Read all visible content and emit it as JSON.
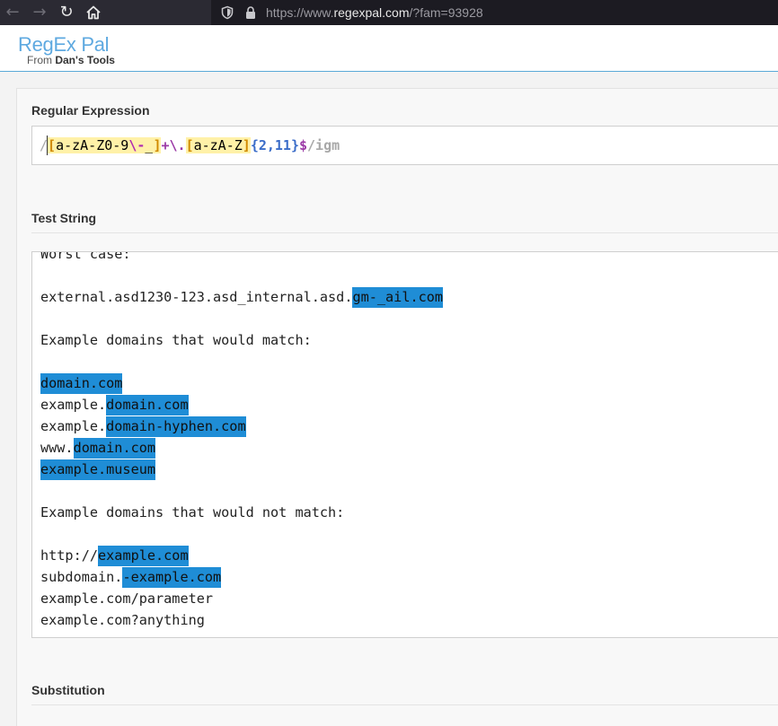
{
  "browser": {
    "url_prefix": "https://www.",
    "url_host": "regexpal.com",
    "url_suffix": "/?fam=93928"
  },
  "header": {
    "brand": "RegEx Pal",
    "from": "From",
    "from_bold": "Dan's Tools"
  },
  "regex": {
    "title": "Regular Expression",
    "tokens": {
      "open_delim": "/",
      "bracket_open": "[",
      "class1": "a-zA-Z0-9",
      "esc": "\\-",
      "underscore": "_",
      "bracket_close": "]",
      "plus": "+",
      "escdot": "\\.",
      "bracket_open2": "[",
      "class2": "a-zA-Z",
      "bracket_close2": "]",
      "quant": "{2,11}",
      "anchor": "$",
      "flags": "/igm"
    }
  },
  "test_string": {
    "title": "Test String",
    "lines": [
      {
        "text": "Worst case:"
      },
      {
        "text": ""
      },
      {
        "pre": "external.asd1230-123.asd_internal.asd.",
        "match": "gm-_ail.com"
      },
      {
        "text": ""
      },
      {
        "text": "Example domains that would match:"
      },
      {
        "text": ""
      },
      {
        "pre": "",
        "match": "domain.com"
      },
      {
        "pre": "example.",
        "match": "domain.com"
      },
      {
        "pre": "example.",
        "match": "domain-hyphen.com"
      },
      {
        "pre": "www.",
        "match": "domain.com"
      },
      {
        "pre": "",
        "match": "example.museum"
      },
      {
        "text": ""
      },
      {
        "text": "Example domains that would not match:"
      },
      {
        "text": ""
      },
      {
        "pre": "http://",
        "match": "example.com"
      },
      {
        "pre": "subdomain.",
        "match": "-example.com"
      },
      {
        "text": "example.com/parameter"
      },
      {
        "text": "example.com?anything"
      }
    ]
  },
  "substitution": {
    "title": "Substitution"
  },
  "colors": {
    "brand": "#5ea9e0",
    "match_highlight": "#1f8dd6",
    "char_class_bg": "#fff1a8"
  }
}
